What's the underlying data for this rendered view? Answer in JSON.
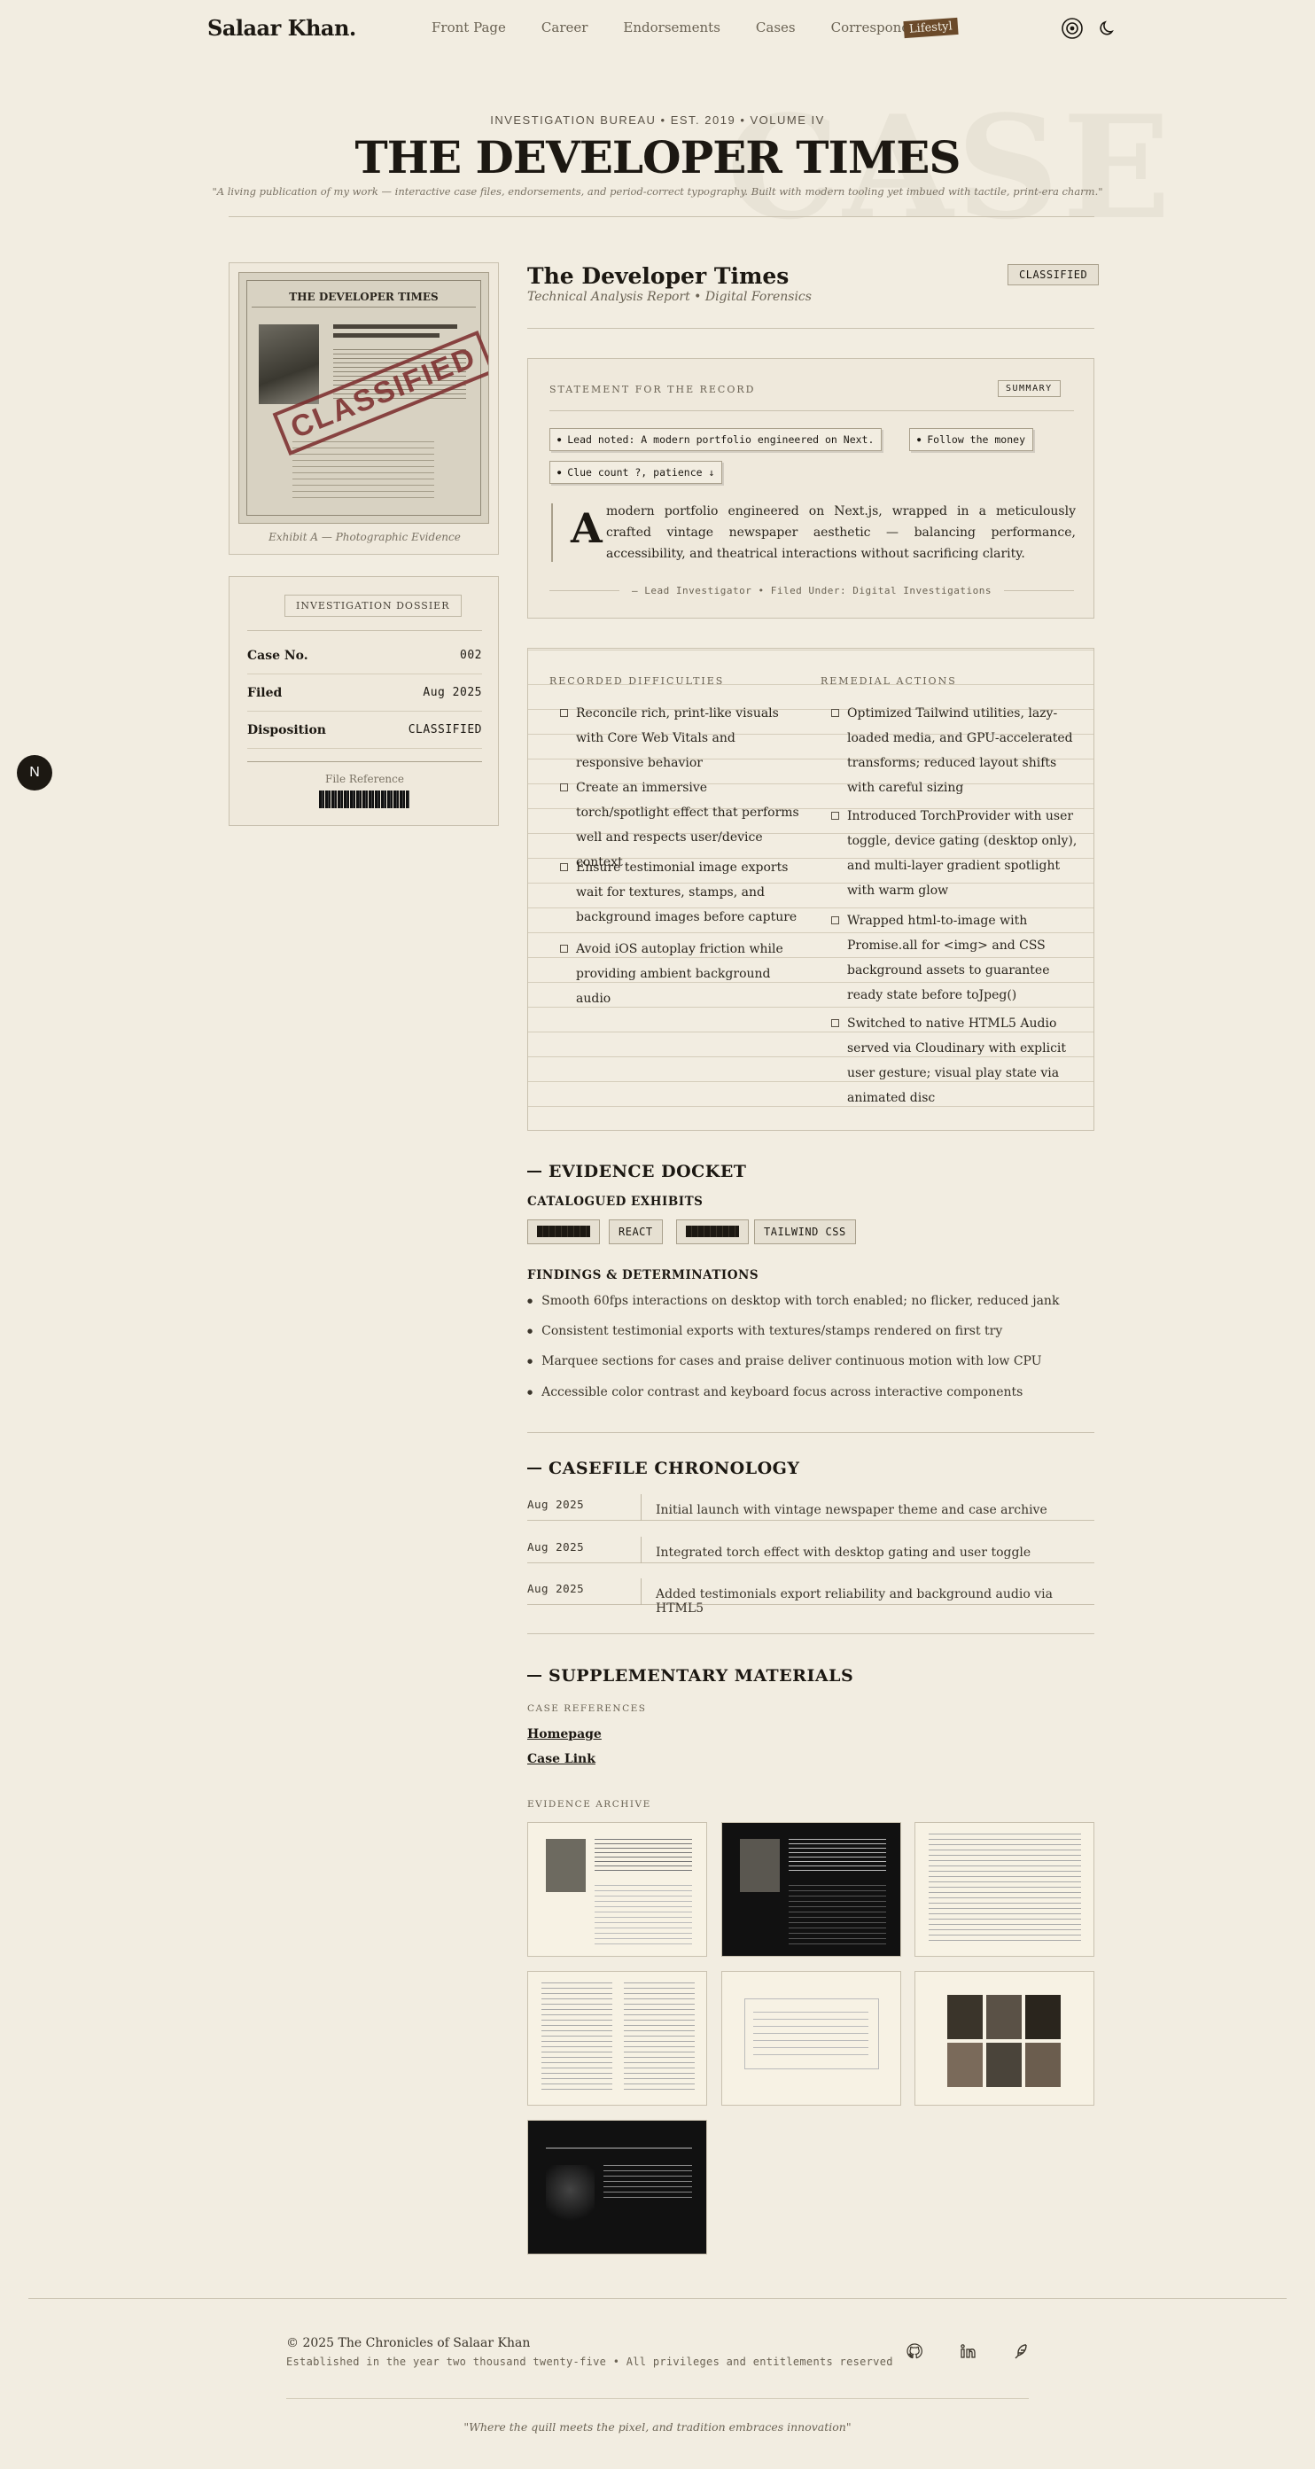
{
  "nav": {
    "brand": "Salaar Khan.",
    "links": [
      "Front Page",
      "Career",
      "Endorsements",
      "Cases",
      "Correspondence"
    ],
    "lifestyle": "Lifestyl",
    "icons": [
      "torch-toggle-icon",
      "moon-icon"
    ]
  },
  "masthead": {
    "kicker": "INVESTIGATION BUREAU • EST. 2019 • VOLUME IV",
    "title": "THE DEVELOPER TIMES",
    "tagline": "\"A living publication of my work — interactive case files, endorsements, and period-correct typography. Built with modern tooling yet imbued with tactile, print-era charm.\"",
    "ghost": "CASE"
  },
  "exhibit": {
    "stamp": "CLASSIFIED",
    "caption": "Exhibit A — Photographic Evidence"
  },
  "dossier": {
    "title": "INVESTIGATION DOSSIER",
    "rows": [
      {
        "k": "Case No.",
        "v": "002"
      },
      {
        "k": "Filed",
        "v": "Aug 2025"
      },
      {
        "k": "Disposition",
        "v": "CLASSIFIED"
      }
    ],
    "file_ref": "File Reference"
  },
  "fab": "N",
  "case": {
    "title": "The Developer Times",
    "subtitle": "Technical Analysis Report • Digital Forensics",
    "badge": "CLASSIFIED"
  },
  "statement": {
    "label": "STATEMENT FOR THE RECORD",
    "badge": "SUMMARY",
    "chips": [
      "Lead noted: A modern portfolio engineered on Next.",
      "Follow the money",
      "Clue count ?, patience ↓"
    ],
    "dropcap": "A",
    "body": "modern portfolio engineered on Next.js, wrapped in a meticulously crafted vintage newspaper aesthetic — balancing performance, accessibility, and theatrical interactions without sacrificing clarity.",
    "footer": "— Lead Investigator • Filed Under: Digital Investigations"
  },
  "difficulties": {
    "left_head": "RECORDED DIFFICULTIES",
    "right_head": "REMEDIAL ACTIONS",
    "left": [
      "Reconcile rich, print-like visuals with Core Web Vitals and responsive behavior",
      "Create an immersive torch/spotlight effect that performs well and respects user/device context",
      "Ensure testimonial image exports wait for textures, stamps, and background images before capture",
      "Avoid iOS autoplay friction while providing ambient background audio"
    ],
    "right": [
      "Optimized Tailwind utilities, lazy-loaded media, and GPU-accelerated transforms; reduced layout shifts with careful sizing",
      "Introduced TorchProvider with user toggle, device gating (desktop only), and multi-layer gradient spotlight with warm glow",
      "Wrapped html-to-image with Promise.all for <img> and CSS background assets to guarantee ready state before toJpeg()",
      "Switched to native HTML5 Audio served via Cloudinary with explicit user gesture; visual play state via animated disc"
    ]
  },
  "evidence": {
    "title": "EVIDENCE DOCKET",
    "exhibits_title": "CATALOGUED EXHIBITS",
    "tags": [
      "",
      "REACT",
      "",
      "TAILWIND CSS"
    ],
    "findings_title": "FINDINGS & DETERMINATIONS",
    "findings": [
      "Smooth 60fps interactions on desktop with torch enabled; no flicker, reduced jank",
      "Consistent testimonial exports with textures/stamps rendered on first try",
      "Marquee sections for cases and praise deliver continuous motion with low CPU",
      "Accessible color contrast and keyboard focus across interactive components"
    ]
  },
  "chronology": {
    "title": "CASEFILE CHRONOLOGY",
    "items": [
      {
        "date": "Aug 2025",
        "text": "Initial launch with vintage newspaper theme and case archive"
      },
      {
        "date": "Aug 2025",
        "text": "Integrated torch effect with desktop gating and user toggle"
      },
      {
        "date": "Aug 2025",
        "text": "Added testimonials export reliability and background audio via HTML5"
      }
    ]
  },
  "supplementary": {
    "title": "SUPPLEMENTARY MATERIALS",
    "refs_label": "CASE REFERENCES",
    "links": [
      "Homepage",
      "Case Link"
    ],
    "archive_label": "EVIDENCE ARCHIVE"
  },
  "footer": {
    "copyright": "© 2025 The Chronicles of Salaar Khan",
    "established": "Established in the year two thousand twenty-five • All privileges and entitlements reserved",
    "social": [
      "github-icon",
      "linkedin-icon",
      "feather-icon"
    ],
    "quote": "\"Where the quill meets the pixel, and tradition embraces innovation\""
  }
}
